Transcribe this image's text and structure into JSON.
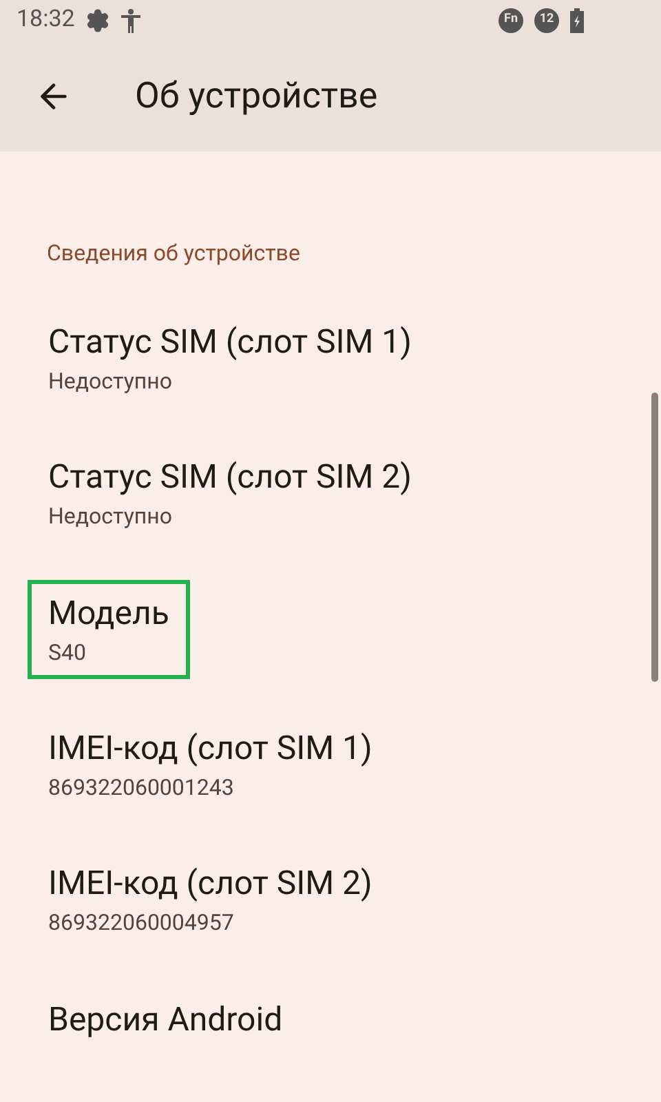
{
  "status_bar": {
    "time": "18:32",
    "badges": [
      "Fn",
      "12"
    ]
  },
  "header": {
    "title": "Об устройстве"
  },
  "section": {
    "title": "Сведения об устройстве"
  },
  "items": [
    {
      "title": "Статус SIM (слот SIM 1)",
      "summary": "Недоступно",
      "highlighted": false
    },
    {
      "title": "Статус SIM (слот SIM 2)",
      "summary": "Недоступно",
      "highlighted": false
    },
    {
      "title": "Модель",
      "summary": "S40",
      "highlighted": true
    },
    {
      "title": "IMEI-код (слот SIM 1)",
      "summary": "869322060001243",
      "highlighted": false
    },
    {
      "title": "IMEI-код (слот SIM 2)",
      "summary": "869322060004957",
      "highlighted": false
    },
    {
      "title": "Версия Android",
      "highlighted": false
    }
  ]
}
